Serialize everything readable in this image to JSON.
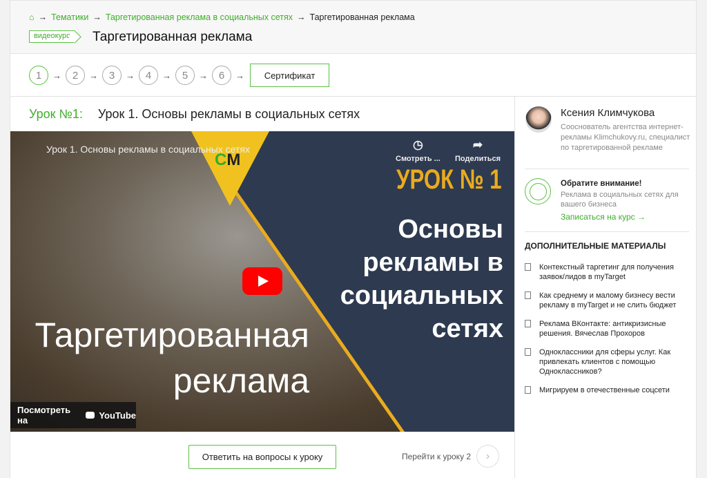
{
  "breadcrumb": {
    "items": [
      "Тематики",
      "Таргетированная реклама в социальных сетях"
    ],
    "current": "Таргетированная реклама",
    "separator": "→"
  },
  "header": {
    "badge": "видеокурс",
    "title": "Таргетированная реклама"
  },
  "steps": {
    "items": [
      "1",
      "2",
      "3",
      "4",
      "5",
      "6"
    ],
    "active": "1",
    "certificate": "Сертификат"
  },
  "lesson": {
    "number": "Урок №1:",
    "title": "Урок 1. Основы рекламы в социальных сетях"
  },
  "video": {
    "title": "Урок 1. Основы рекламы в социальных сетях",
    "watch_later": "Смотреть ...",
    "share": "Поделиться",
    "logo": "CM",
    "badge": "УРОК № 1",
    "headline": [
      "Основы",
      "рекламы в",
      "социальных",
      "сетях"
    ],
    "overlay": [
      "Таргетированная",
      "реклама"
    ],
    "watch_on": "Посмотреть на",
    "youtube": "YouTube"
  },
  "actions": {
    "answer": "Ответить на вопросы к уроку",
    "next": "Перейти к уроку 2"
  },
  "author": {
    "name": "Ксения Климчукова",
    "desc": "Сооснователь агентства интернет-рекламы Klimchukovy.ru, специалист по таргетированной рекламе"
  },
  "notice": {
    "title": "Обратите внимание!",
    "text": "Реклама в социальных сетях для вашего бизнеса",
    "link": "Записаться на курс →"
  },
  "materials": {
    "heading": "ДОПОЛНИТЕЛЬНЫЕ МАТЕРИАЛЫ",
    "items": [
      "Контекстный таргетинг для получения заявок/лидов в myTarget",
      "Как среднему и малому бизнесу вести рекламу в myTarget и не слить бюджет",
      "Реклама ВКонтакте: антикризисные решения. Вячеслав Прохоров",
      "Одноклассники для сферы услуг. Как привлекать клиентов с помощью Одноклассников?",
      "Мигрируем в отечественные соцсети"
    ]
  },
  "colors": {
    "accent": "#3fae2a",
    "video_bg": "#2e3a50",
    "video_yellow": "#e9ab1f"
  }
}
